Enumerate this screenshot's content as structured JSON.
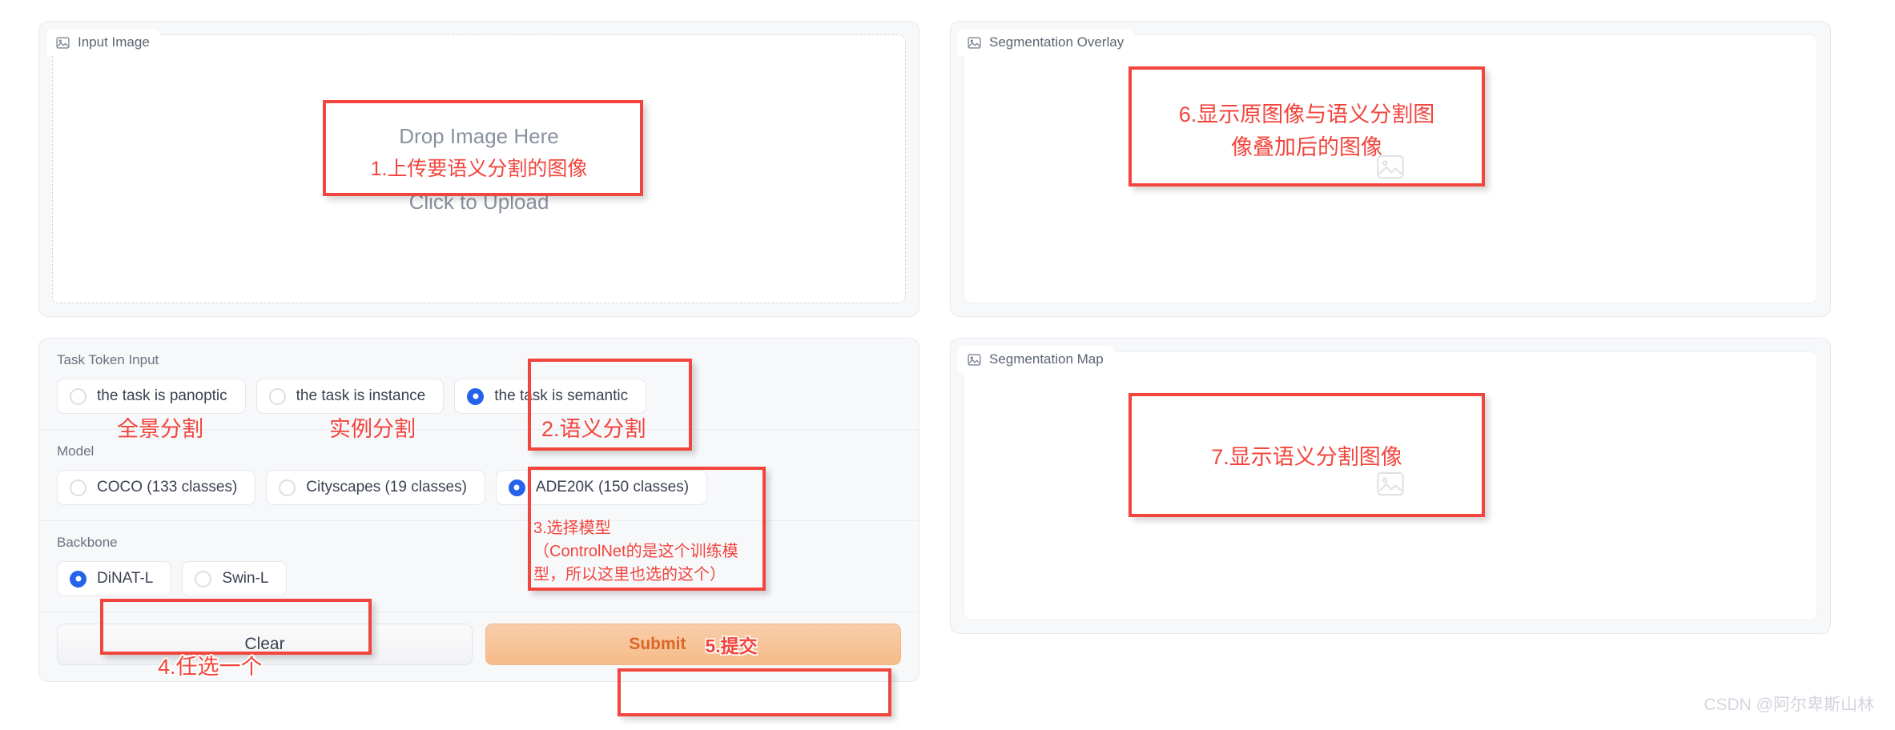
{
  "left": {
    "input_panel": {
      "chip_label": "Input Image",
      "chip_icon": "image-icon",
      "drop_line1": "Drop Image Here",
      "drop_line2": "1.上传要语义分割的图像",
      "drop_line3": "Click to Upload"
    },
    "task_group": {
      "label": "Task Token Input",
      "options": [
        {
          "label": "the task is panoptic",
          "selected": false,
          "annotation": "全景分割"
        },
        {
          "label": "the task is instance",
          "selected": false,
          "annotation": "实例分割"
        },
        {
          "label": "the task is semantic",
          "selected": true,
          "annotation": "2.语义分割"
        }
      ]
    },
    "model_group": {
      "label": "Model",
      "options": [
        {
          "label": "COCO (133 classes)",
          "selected": false
        },
        {
          "label": "Cityscapes (19 classes)",
          "selected": false
        },
        {
          "label": "ADE20K (150 classes)",
          "selected": true
        }
      ],
      "annotation_line1": "3.选择模型",
      "annotation_line2": "（ControlNet的是这个训练模",
      "annotation_line3": "型，所以这里也选的这个）"
    },
    "backbone_group": {
      "label": "Backbone",
      "options": [
        {
          "label": "DiNAT-L",
          "selected": true
        },
        {
          "label": "Swin-L",
          "selected": false
        }
      ],
      "annotation": "4.任选一个"
    },
    "actions": {
      "clear_label": "Clear",
      "submit_label": "Submit",
      "submit_annotation": "5.提交"
    }
  },
  "right": {
    "overlay_panel": {
      "chip_label": "Segmentation Overlay",
      "chip_icon": "image-icon",
      "annotation_line1": "6.显示原图像与语义分割图",
      "annotation_line2": "像叠加后的图像"
    },
    "map_panel": {
      "chip_label": "Segmentation Map",
      "chip_icon": "image-icon",
      "annotation": "7.显示语义分割图像"
    }
  },
  "watermark": "CSDN @阿尔卑斯山林",
  "colors": {
    "annotation_red": "#f2453d",
    "radio_blue": "#2563eb",
    "submit_orange": "#d9672a",
    "panel_bg": "#f7f8fa"
  }
}
